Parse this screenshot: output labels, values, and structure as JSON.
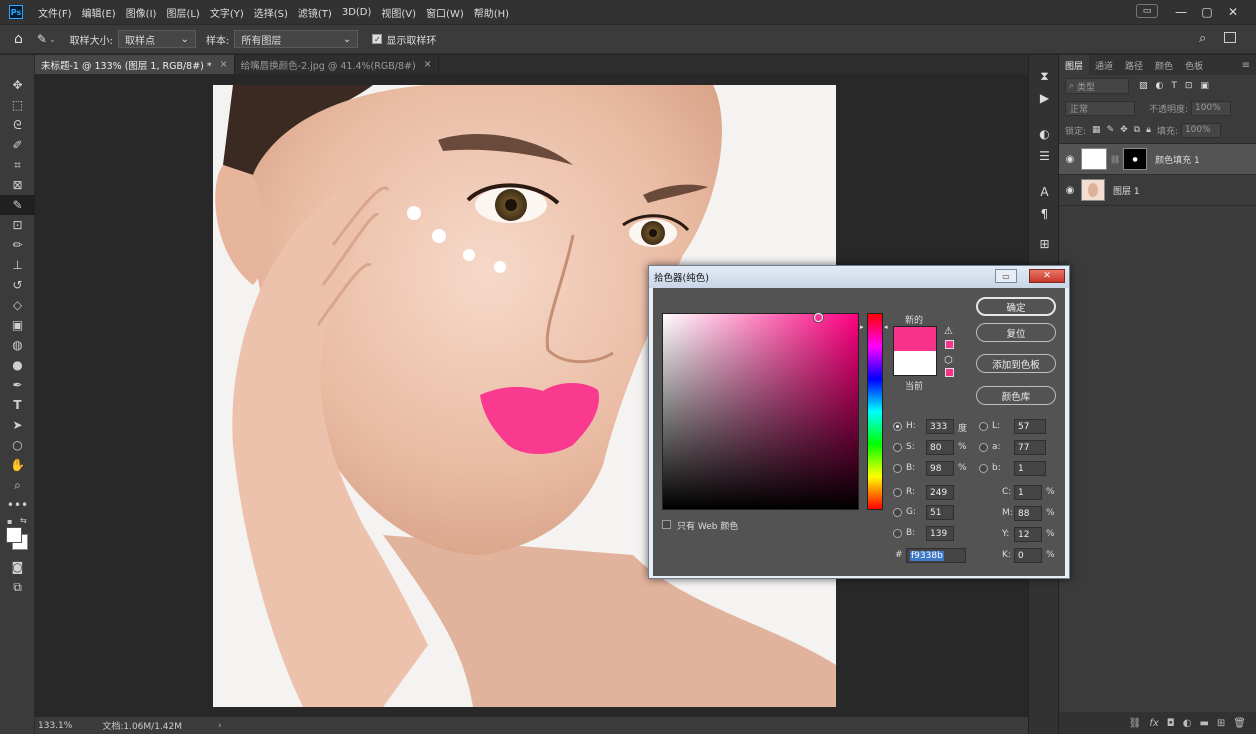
{
  "menubar": {
    "logo": "Ps",
    "items": [
      "文件(F)",
      "编辑(E)",
      "图像(I)",
      "图层(L)",
      "文字(Y)",
      "选择(S)",
      "滤镜(T)",
      "3D(D)",
      "视图(V)",
      "窗口(W)",
      "帮助(H)"
    ]
  },
  "options": {
    "sample_size_label": "取样大小:",
    "sample_size_value": "取样点",
    "sample_label": "样本:",
    "sample_value": "所有图层",
    "show_ring_label": "显示取样环"
  },
  "tabs": [
    {
      "label": "未标题-1 @ 133% (图层 1, RGB/8#) *",
      "active": true
    },
    {
      "label": "给嘴唇换颜色-2.jpg @ 41.4%(RGB/8#)",
      "active": false
    }
  ],
  "statusbar": {
    "zoom": "133.1%",
    "doc": "文档:1.06M/1.42M"
  },
  "panel": {
    "tabs": [
      "图层",
      "通道",
      "路径",
      "颜色",
      "色板"
    ],
    "filter_label": "类型",
    "blend_mode": "正常",
    "opacity_label": "不透明度:",
    "opacity_value": "100%",
    "lock_label": "锁定:",
    "fill_label": "填充:",
    "fill_value": "100%",
    "layers": [
      {
        "name": "颜色填充 1",
        "selected": true
      },
      {
        "name": "图层 1",
        "selected": false
      }
    ]
  },
  "dialog": {
    "title": "拾色器(纯色)",
    "buttons": {
      "ok": "确定",
      "reset": "复位",
      "add_swatch": "添加到色板",
      "libraries": "颜色库"
    },
    "new_label": "新的",
    "current_label": "当前",
    "web_only_label": "只有 Web 颜色",
    "fields": {
      "H": {
        "label": "H:",
        "value": "333",
        "unit": "度"
      },
      "S": {
        "label": "S:",
        "value": "80",
        "unit": "%"
      },
      "B": {
        "label": "B:",
        "value": "98",
        "unit": "%"
      },
      "R": {
        "label": "R:",
        "value": "249"
      },
      "G": {
        "label": "G:",
        "value": "51"
      },
      "Bb": {
        "label": "B:",
        "value": "139"
      },
      "L": {
        "label": "L:",
        "value": "57"
      },
      "a": {
        "label": "a:",
        "value": "77"
      },
      "b": {
        "label": "b:",
        "value": "1"
      },
      "C": {
        "label": "C:",
        "value": "1",
        "unit": "%"
      },
      "M": {
        "label": "M:",
        "value": "88",
        "unit": "%"
      },
      "Y": {
        "label": "Y:",
        "value": "12",
        "unit": "%"
      },
      "K": {
        "label": "K:",
        "value": "0",
        "unit": "%"
      }
    },
    "hex_label": "#",
    "hex_value": "f9338b",
    "new_color": "#f9338b",
    "current_color": "#ffffff",
    "hue_color": "#ff0080"
  },
  "colors": {
    "lip": "#f93a8e",
    "accent": "#f9338b"
  }
}
